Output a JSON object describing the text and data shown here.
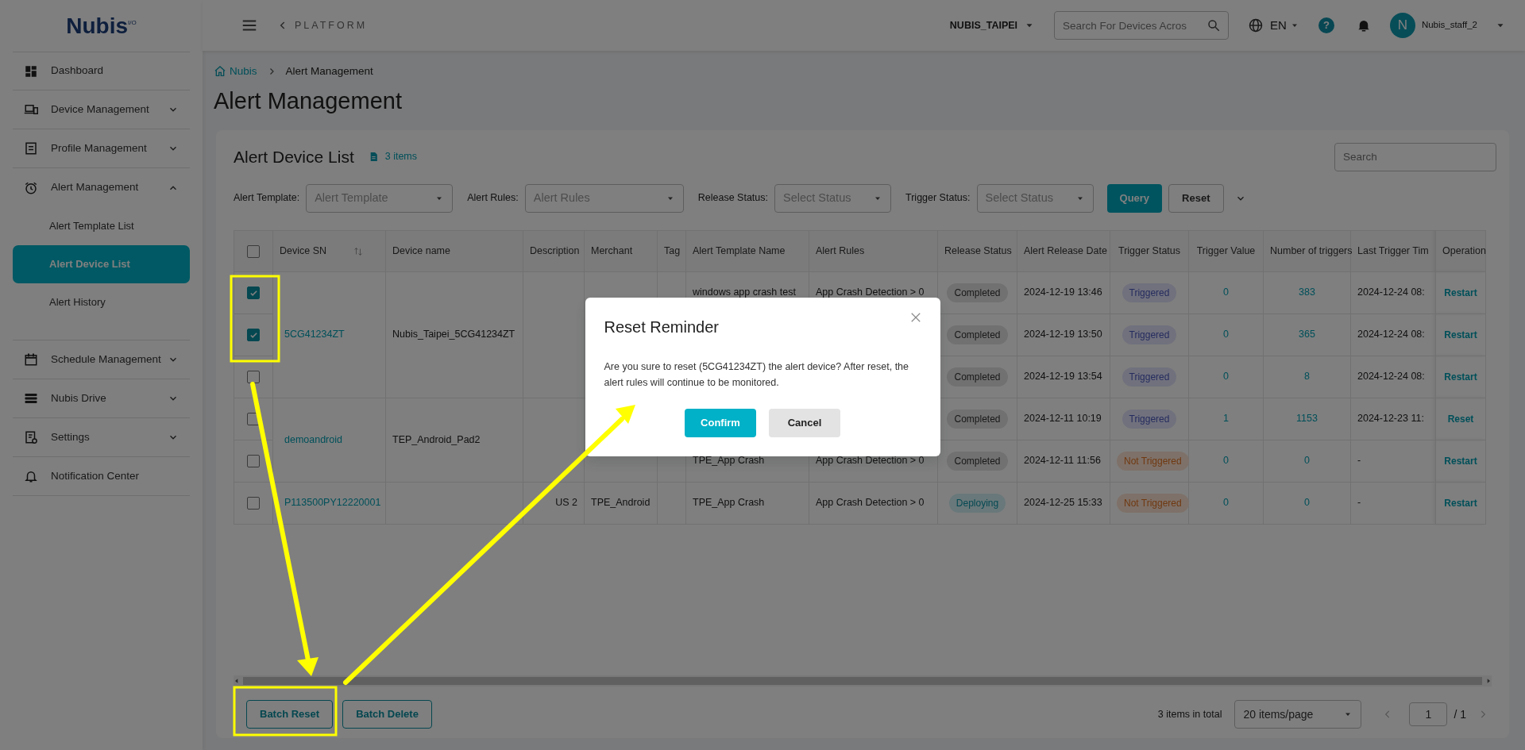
{
  "sidebar": {
    "logo": {
      "text": "Nubis",
      "mark": "I/O"
    },
    "items": [
      {
        "label": "Dashboard",
        "kind": "link"
      },
      {
        "label": "Device Management",
        "kind": "group",
        "expanded": false
      },
      {
        "label": "Profile Management",
        "kind": "group",
        "expanded": false
      },
      {
        "label": "Alert Management",
        "kind": "group",
        "expanded": true,
        "children": [
          {
            "label": "Alert Template List",
            "selected": false
          },
          {
            "label": "Alert Device List",
            "selected": true
          },
          {
            "label": "Alert History",
            "selected": false
          }
        ]
      },
      {
        "label": "Schedule Management",
        "kind": "group",
        "expanded": false
      },
      {
        "label": "Nubis Drive",
        "kind": "group",
        "expanded": false
      },
      {
        "label": "Settings",
        "kind": "group",
        "expanded": false
      },
      {
        "label": "Notification Center",
        "kind": "link"
      }
    ]
  },
  "header": {
    "back_label": "PLATFORM",
    "organization": "NUBIS_TAIPEI",
    "search": {
      "placeholder": "Search For Devices Acros"
    },
    "language": "EN",
    "help": "?",
    "avatar": "N",
    "user": "Nubis_staff_2"
  },
  "breadcrumb": [
    {
      "label": "Nubis",
      "kind": "home"
    },
    {
      "label": "Alert Management",
      "kind": "current"
    }
  ],
  "page_title": "Alert Management",
  "card": {
    "title": "Alert Device List",
    "count": "3 items",
    "search": {
      "placeholder": "Search"
    },
    "filters": [
      {
        "label": "Alert Template:",
        "placeholder": "Alert Template"
      },
      {
        "label": "Alert Rules:",
        "placeholder": "Alert Rules"
      },
      {
        "label": "Release Status:",
        "placeholder": "Select Status"
      },
      {
        "label": "Trigger Status:",
        "placeholder": "Select Status"
      }
    ],
    "buttons": [
      {
        "label": "Query",
        "kind": "primary"
      },
      {
        "label": "Reset",
        "kind": "secondary"
      }
    ]
  },
  "table": {
    "select_all": false,
    "columns": [
      "Device SN",
      "Device name",
      "Description",
      "Merchant",
      "Tag",
      "Alert Template Name",
      "Alert Rules",
      "Release Status",
      "Alert Release Date",
      "Trigger Status",
      "Trigger Value",
      "Number of triggers",
      "Last Trigger Tim",
      "Operation"
    ],
    "devices": [
      {
        "sn": "5CG41234ZT",
        "name": "Nubis_Taipei_5CG41234ZT",
        "alerts": [
          {
            "checked": true,
            "template": "windows app crash test",
            "rules": "App Crash Detection > 0",
            "release_status": {
              "text": "Completed",
              "kind": "completed"
            },
            "release_date": "2024-12-19 13:46",
            "trigger_status": {
              "text": "Triggered",
              "kind": "triggered"
            },
            "trigger_value": "0",
            "triggers": "383",
            "last_trigger": "2024-12-24 08:",
            "operation": "Restart"
          },
          {
            "checked": true,
            "release_status": {
              "text": "Completed",
              "kind": "completed"
            },
            "release_date": "2024-12-19 13:50",
            "trigger_status": {
              "text": "Triggered",
              "kind": "triggered"
            },
            "trigger_value": "0",
            "triggers": "365",
            "last_trigger": "2024-12-24 08:",
            "operation": "Restart"
          },
          {
            "checked": false,
            "release_status": {
              "text": "Completed",
              "kind": "completed"
            },
            "release_date": "2024-12-19 13:54",
            "trigger_status": {
              "text": "Triggered",
              "kind": "triggered"
            },
            "trigger_value": "0",
            "triggers": "8",
            "last_trigger": "2024-12-24 08:",
            "operation": "Restart"
          }
        ]
      },
      {
        "sn": "demoandroid",
        "name": "TEP_Android_Pad2",
        "alerts": [
          {
            "checked": false,
            "release_status": {
              "text": "Completed",
              "kind": "completed"
            },
            "release_date": "2024-12-11 10:19",
            "trigger_status": {
              "text": "Triggered",
              "kind": "triggered"
            },
            "trigger_value": "1",
            "triggers": "1153",
            "last_trigger": "2024-12-23 11:",
            "operation": "Reset"
          },
          {
            "checked": false,
            "template": "TPE_App Crash",
            "rules": "App Crash Detection > 0",
            "release_status": {
              "text": "Completed",
              "kind": "completed"
            },
            "release_date": "2024-12-11 11:56",
            "trigger_status": {
              "text": "Not Triggered",
              "kind": "not_triggered"
            },
            "trigger_value": "0",
            "triggers": "0",
            "last_trigger": "-",
            "operation": "Restart"
          }
        ]
      },
      {
        "sn": "P113500PY12220001",
        "description": "US 2",
        "merchant": "TPE_Android",
        "alerts": [
          {
            "checked": false,
            "template": "TPE_App Crash",
            "rules": "App Crash Detection > 0",
            "release_status": {
              "text": "Deploying",
              "kind": "deploying"
            },
            "release_date": "2024-12-25 15:33",
            "trigger_status": {
              "text": "Not Triggered",
              "kind": "not_triggered"
            },
            "trigger_value": "0",
            "triggers": "0",
            "last_trigger": "-",
            "operation": "Restart"
          }
        ]
      }
    ]
  },
  "footer": {
    "buttons": [
      "Batch Reset",
      "Batch Delete"
    ],
    "total": "3 items in total",
    "page_size": "20 items/page",
    "page": "1",
    "pages": "/ 1"
  },
  "dialog": {
    "title": "Reset Reminder",
    "message": "Are you sure to reset (5CG41234ZT) the alert device? After reset, the alert rules will continue to be monitored.",
    "buttons": [
      {
        "label": "Confirm",
        "kind": "primary"
      },
      {
        "label": "Cancel",
        "kind": "secondary"
      }
    ]
  }
}
